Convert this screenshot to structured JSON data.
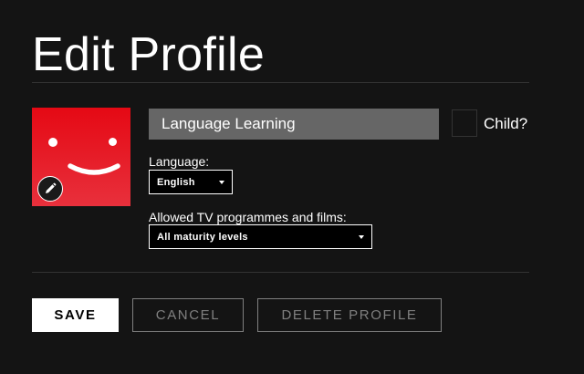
{
  "page": {
    "title": "Edit Profile"
  },
  "profile": {
    "avatar_icon": "smiley-face-avatar",
    "edit_icon": "pencil-icon",
    "name_value": "Language Learning",
    "accent_color": "#e50914"
  },
  "child": {
    "label": "Child?",
    "checked": false
  },
  "language": {
    "label": "Language:",
    "selected": "English"
  },
  "maturity": {
    "label": "Allowed TV programmes and films:",
    "selected": "All maturity levels"
  },
  "buttons": {
    "save": "SAVE",
    "cancel": "CANCEL",
    "delete": "DELETE PROFILE"
  }
}
